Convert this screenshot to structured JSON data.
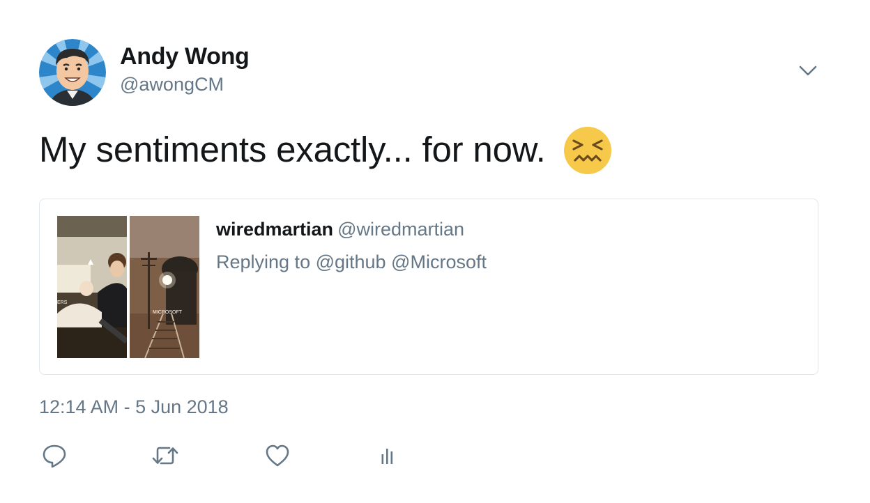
{
  "author": {
    "name": "Andy Wong",
    "handle": "@awongCM",
    "avatar_icon": "cartoon-avatar"
  },
  "tweet": {
    "text": "My sentiments exactly... for now.",
    "emoji_icon": "confounded-face-emoji",
    "timestamp": "12:14 AM - 5 Jun 2018"
  },
  "quoted_tweet": {
    "name": "wiredmartian",
    "handle": "@wiredmartian",
    "replying_to": "Replying to @github @Microsoft",
    "media": [
      {
        "caption": "ERS"
      },
      {
        "caption": "MICROSOFT"
      }
    ]
  },
  "actions": [
    {
      "name": "reply",
      "icon": "reply-icon"
    },
    {
      "name": "retweet",
      "icon": "retweet-icon"
    },
    {
      "name": "like",
      "icon": "heart-icon"
    },
    {
      "name": "analytics",
      "icon": "analytics-icon"
    }
  ],
  "colors": {
    "primary_text": "#14171a",
    "secondary_text": "#657786",
    "border": "#e1e8ed",
    "icon": "#657786"
  }
}
